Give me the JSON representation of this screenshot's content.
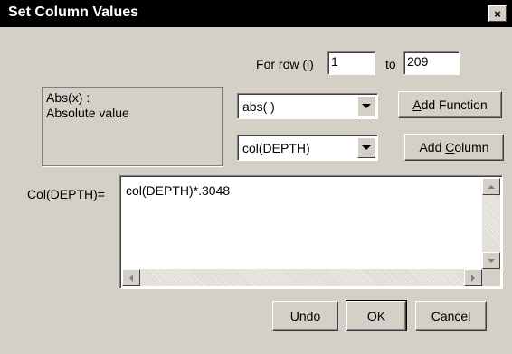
{
  "window": {
    "title": "Set Column Values",
    "close_glyph": "×",
    "close_icon": "close-icon"
  },
  "row_range": {
    "label_accel": "F",
    "label_rest": "or row (i)",
    "from_value": "1",
    "to_accel": "t",
    "to_rest": "o",
    "to_value": "209"
  },
  "function_help": {
    "signature": "Abs(x) :",
    "description": "Absolute value"
  },
  "function_select": {
    "selected": "abs( )",
    "dropdown_icon": "chevron-down-icon"
  },
  "column_select": {
    "selected": "col(DEPTH)",
    "dropdown_icon": "chevron-down-icon"
  },
  "buttons": {
    "add_function_accel": "A",
    "add_function_rest": "dd Function",
    "add_column_pre": "Add ",
    "add_column_accel": "C",
    "add_column_rest": "olumn",
    "undo": "Undo",
    "ok": "OK",
    "cancel": "Cancel"
  },
  "formula": {
    "label": "Col(DEPTH)=",
    "value": "col(DEPTH)*.3048"
  },
  "colors": {
    "titlebar": "#000000",
    "face": "#d4d0c8",
    "field": "#ffffff"
  }
}
